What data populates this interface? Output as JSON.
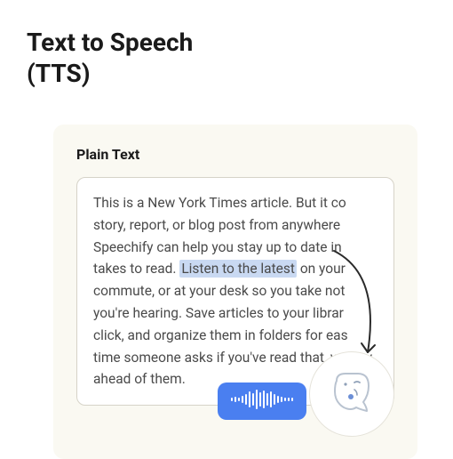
{
  "title_line1": "Text to Speech",
  "title_line2": "(TTS)",
  "card": {
    "label": "Plain Text",
    "body_before": "This is a New York Times article. But it co story, report, or blog post from anywhere Speechify can help you stay up to date in takes to read. ",
    "highlight": "Listen to the latest",
    "body_after": " on your commute, or at your desk so you take not you're hearing. Save articles to your librar click, and organize them in folders for eas time someone asks if you've read that, yo way ahead of them."
  },
  "icons": {
    "audio": "audio-waveform-icon",
    "face": "speaking-face-icon",
    "arrow": "curved-arrow-icon"
  },
  "colors": {
    "accent": "#4a7ff0",
    "highlight": "#c9d9f2",
    "card_bg": "#faf9f2"
  }
}
